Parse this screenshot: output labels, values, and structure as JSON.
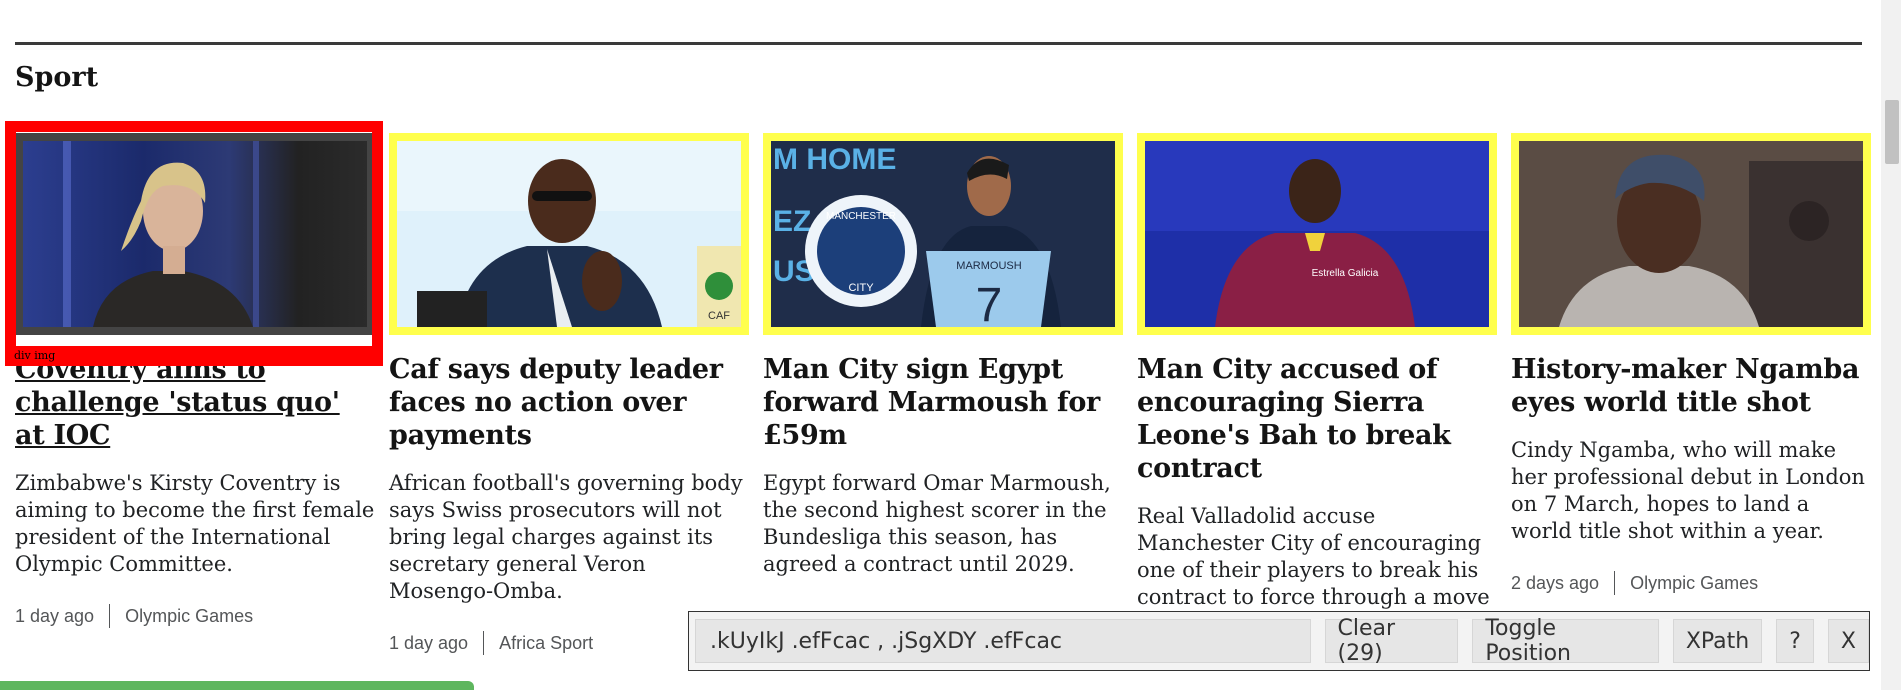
{
  "section": {
    "title": "Sport"
  },
  "cards": [
    {
      "headline": "Coventry aims to challenge 'status quo' at IOC",
      "summary": "Zimbabwe's Kirsty Coventry is aiming to become the first female president of the International Olympic Committee.",
      "time": "1 day ago",
      "tag": "Olympic Games"
    },
    {
      "headline": "Caf says deputy leader faces no action over payments",
      "summary": "African football's governing body says Swiss prosecutors will not bring legal charges against its secretary general Veron Mosengo-Omba.",
      "time": "1 day ago",
      "tag": "Africa Sport"
    },
    {
      "headline": "Man City sign Egypt forward Marmoush for £59m",
      "summary": "Egypt forward Omar Marmoush, the second highest scorer in the Bundesliga this season, has agreed a contract until 2029.",
      "time": "",
      "tag": ""
    },
    {
      "headline": "Man City accused of encouraging Sierra Leone's Bah to break contract",
      "summary": "Real Valladolid accuse Manchester City of encouraging one of their players to break his contract to force through a move to the Premier League club.",
      "time": "",
      "tag": ""
    },
    {
      "headline": "History-maker Ngamba eyes world title shot",
      "summary": "Cindy Ngamba, who will make her professional debut in London on 7 March, hopes to land a world title shot within a year.",
      "time": "2 days ago",
      "tag": "Olympic Games"
    }
  ],
  "images": {
    "card1_logo_text": "CAF",
    "card2_wall_text": [
      "M HOME",
      "EZ",
      "US"
    ],
    "card2_badge_top": "MANCHESTER",
    "card2_badge_bottom": "CITY",
    "card2_shirt_name": "MARMOUSH",
    "card2_shirt_number": "7",
    "card3_sponsor": "Estrella Galicia"
  },
  "selector_overlay": {
    "label": "div img"
  },
  "toolbar": {
    "query": ".kUyIkJ .efFcac , .jSgXDY .efFcac",
    "clear_label": "Clear (29)",
    "toggle_label": "Toggle Position",
    "xpath_label": "XPath",
    "help_label": "?",
    "close_label": "X"
  },
  "colors": {
    "highlight": "#ffff4d",
    "selected": "#ff0000",
    "progress": "#5eb65e"
  }
}
